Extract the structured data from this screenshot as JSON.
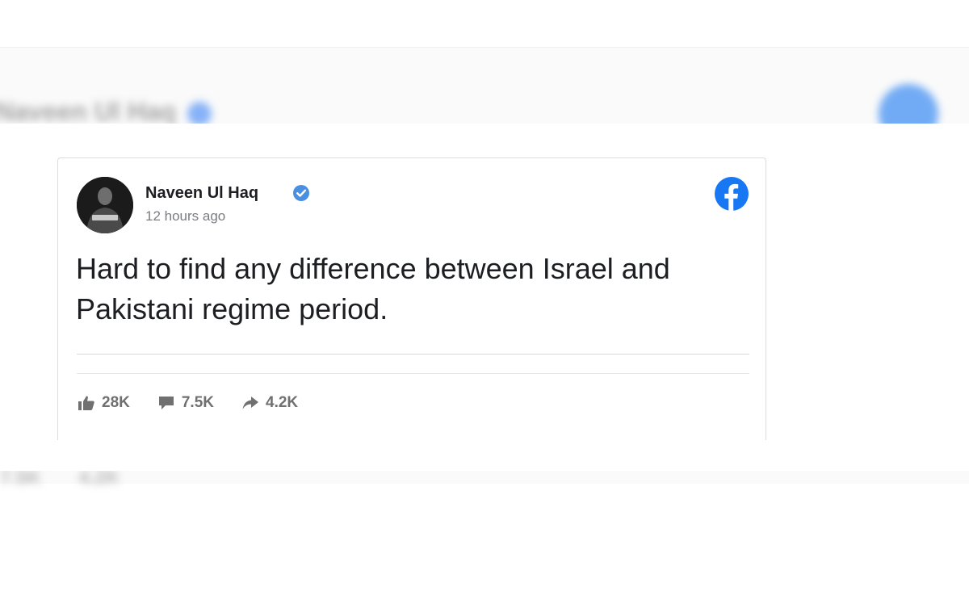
{
  "post": {
    "author": "Naveen Ul Haq",
    "timestamp": "12 hours ago",
    "text": "Hard to find any difference between Israel and Pakistani regime period.",
    "platform_icon": "facebook-icon",
    "verified_icon": "verified-badge-icon"
  },
  "stats": {
    "likes": "28K",
    "comments": "7.5K",
    "shares": "4.2K"
  },
  "colors": {
    "facebook_blue": "#1877f2",
    "text": "#1c1e21",
    "muted": "#7a7d81"
  }
}
